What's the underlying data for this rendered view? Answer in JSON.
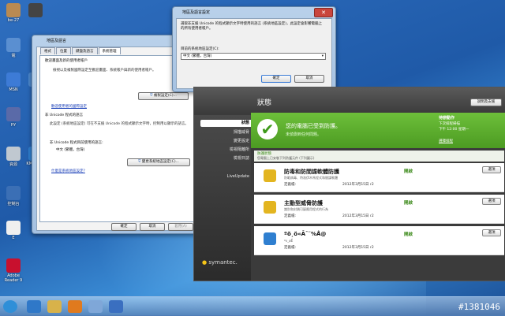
{
  "desktop_icons": [
    {
      "label": "be-27",
      "color": "#b98a52"
    },
    {
      "label": "",
      "color": "#444444"
    },
    {
      "label": "電",
      "color": "#5a8fd1"
    },
    {
      "label": "網",
      "color": "#4d88cc"
    },
    {
      "label": "MSN",
      "color": "#3d7bd6"
    },
    {
      "label": "py",
      "color": "#5a6aa8"
    },
    {
      "label": "資源",
      "color": "#c0c8d0"
    },
    {
      "label": "控制台",
      "color": "#3b6fb5"
    },
    {
      "label": "E",
      "color": "#efefef"
    },
    {
      "label": "Adobe Reader 9",
      "color": "#c8102e"
    },
    {
      "label": "KMPlayer",
      "color": "#2f7fd0"
    }
  ],
  "region_window": {
    "title": "地區及語言",
    "tabs": [
      "格式",
      "位置",
      "鍵盤及語言",
      "系統管理"
    ],
    "welcome_group": "歡迎畫面及新的使用者帳戶",
    "welcome_text": "檢視以及複製國際設定至歡迎畫面、系統帳戶與新的使用者帳戶。",
    "copy_button": "複製設定(C)...",
    "welcome_link": "歡迎使用者的國際設定",
    "unicode_group": "非 Unicode 程式的語言",
    "unicode_text": "此設定 (系統地區設定) 可在不支援 Unicode 的程式顯示文字時，控制用以顯示的語言。",
    "current_label": "非 Unicode 程式目前使用的語言:",
    "current_value": "中文 (繁體，台灣)",
    "change_locale_button": "變更系統地區設定(C)...",
    "help_link": "什麼是系統地區設定?",
    "ok": "確定",
    "cancel": "取消",
    "apply": "套用(A)"
  },
  "locale_dialog": {
    "title": "地區及語言設定",
    "text": "選取非支援 Unicode 的程式顯示文字時使用的語言 (系統地區設定)，此設定會影響電腦上的所有使用者帳戶。",
    "select_label": "目前的系統地區設定(C):",
    "select_value": "中文 (繁體，台灣)",
    "ok": "確定",
    "cancel": "取消"
  },
  "symantec": {
    "section_title": "狀態",
    "top_right_button": "說明及支援",
    "nav": [
      "狀態",
      "掃描威脅",
      "變更設定",
      "檢視隔離所",
      "檢視日誌",
      "LiveUpdate"
    ],
    "status_title": "您的電腦已受到防護。",
    "status_sub": "未偵測到任何問題。",
    "side_title": "待辦動作",
    "side_line1": "下次排程掃描",
    "side_line2": "下午 12:00 星期一",
    "side_link": "選擇排程",
    "protection_label": "防護狀態",
    "protection_sub": "您電腦上已安裝下列防護元件 (下列圖示)",
    "components": [
      {
        "title": "防毒和防間諜軟體防護",
        "sub": "防範病毒、特洛伊木馬程式和間諜軟體",
        "def_label": "定義檔:",
        "date": "2012年3月15日 r2",
        "status": "開啟",
        "action": "選項"
      },
      {
        "title": "主動型威脅防護",
        "sub": "識別和封鎖可疑應用程式的行為",
        "def_label": "定義檔:",
        "date": "2012年3月15日 r2",
        "status": "開啟",
        "action": "選項"
      },
      {
        "title": "ºõ¸ö«Ã¯¨%Å@",
        "sub": "ºv_øÊ",
        "def_label": "定義檔:",
        "date": "2012年3月15日 r2",
        "status": "開啟",
        "action": "選項"
      }
    ],
    "brand": "symantec."
  },
  "taskbar": {
    "items": [
      {
        "name": "start",
        "color": "#2f8fd8"
      },
      {
        "name": "ie",
        "color": "#2f78c8"
      },
      {
        "name": "explorer",
        "color": "#d8b24a"
      },
      {
        "name": "media",
        "color": "#e07a1e"
      },
      {
        "name": "app",
        "color": "#7fa7d8"
      },
      {
        "name": "network",
        "color": "#3a6fc0"
      }
    ],
    "watermark": "#1381046"
  }
}
